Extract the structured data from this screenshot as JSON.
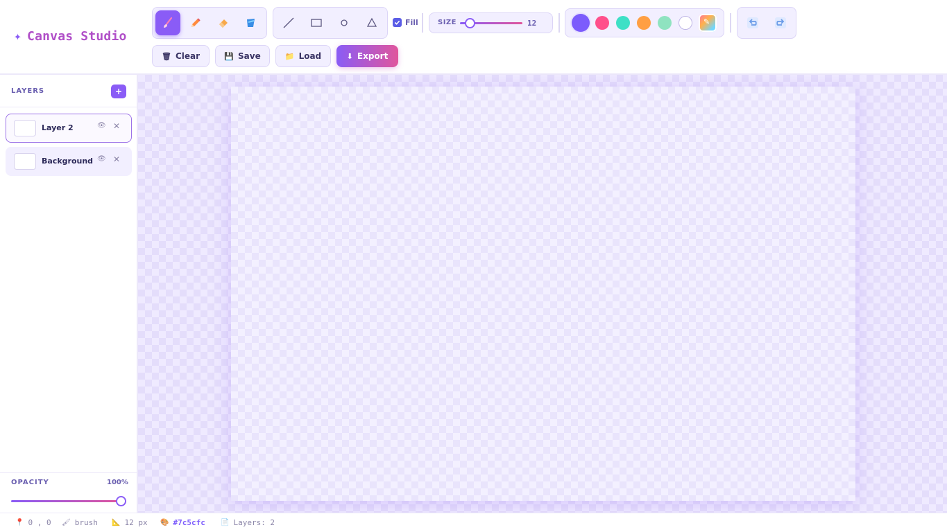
{
  "app": {
    "title": "Canvas Studio",
    "brand_icon": "sparkle"
  },
  "toolbar": {
    "tools": [
      {
        "name": "brush",
        "icon": "brush-icon",
        "active": true
      },
      {
        "name": "pencil",
        "icon": "pencil-icon",
        "active": false
      },
      {
        "name": "eraser",
        "icon": "eraser-icon",
        "active": false
      },
      {
        "name": "fill-bucket",
        "icon": "bucket-icon",
        "active": false
      }
    ],
    "shapes": [
      "line",
      "rectangle",
      "circle",
      "triangle"
    ],
    "fill_label": "Fill",
    "fill_checked": true,
    "size_label": "SIZE",
    "size_value": "12",
    "size_min_max": [
      1,
      60
    ],
    "colors": [
      "#7c5cfc",
      "#ff4f8b",
      "#3ee0c6",
      "#ff9f43",
      "#8fe3c0",
      "#ffffff"
    ],
    "selected_color": "#7c5cfc",
    "actions": {
      "clear": "Clear",
      "save": "Save",
      "load": "Load",
      "export": "Export"
    }
  },
  "layers_panel": {
    "title": "LAYERS",
    "add_label": "+",
    "layers": [
      {
        "name": "Layer 2",
        "selected": true
      },
      {
        "name": "Background",
        "selected": false
      }
    ],
    "opacity_label": "OPACITY",
    "opacity_value": "100%"
  },
  "status": {
    "coords": "0 , 0",
    "tool": "brush",
    "size": "12 px",
    "color": "#7c5cfc",
    "layers": "Layers: 2"
  }
}
